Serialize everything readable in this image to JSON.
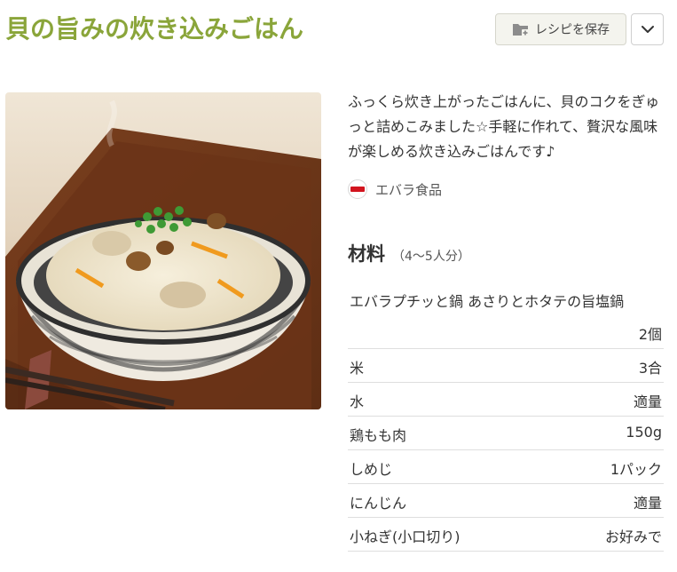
{
  "recipe": {
    "title": "貝の旨みの炊き込みごはん",
    "description": "ふっくら炊き上がったごはんに、貝のコクをぎゅっと詰めこみました☆手軽に作れて、贅沢な風味が楽しめる炊き込みごはんです♪"
  },
  "actions": {
    "save_label": "レシピを保存",
    "save_icon": "folder-add-icon",
    "more_icon": "chevron-down-icon"
  },
  "brand": {
    "name": "エバラ食品",
    "logo_text": "エバラ"
  },
  "ingredients": {
    "title": "材料",
    "servings": "（4〜5人分）",
    "items": [
      {
        "name": "エバラプチッと鍋 あさりとホタテの旨塩鍋",
        "amount": "2個"
      },
      {
        "name": "米",
        "amount": "3合"
      },
      {
        "name": "水",
        "amount": "適量"
      },
      {
        "name": "鶏もも肉",
        "amount": "150g"
      },
      {
        "name": "しめじ",
        "amount": "1パック"
      },
      {
        "name": "にんじん",
        "amount": "適量"
      },
      {
        "name": "小ねぎ(小口切り)",
        "amount": "お好みで"
      }
    ]
  },
  "colors": {
    "title": "#8aa53a",
    "brand_red": "#d2141e"
  }
}
